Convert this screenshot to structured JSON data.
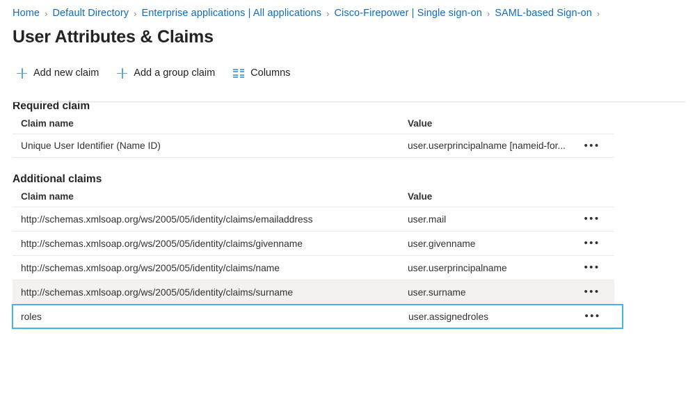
{
  "breadcrumb": {
    "separator": "›",
    "items": [
      {
        "label": "Home"
      },
      {
        "label": "Default Directory"
      },
      {
        "label": "Enterprise applications | All applications"
      },
      {
        "label": "Cisco-Firepower | Single sign-on"
      },
      {
        "label": "SAML-based Sign-on"
      }
    ]
  },
  "page": {
    "title": "User Attributes & Claims"
  },
  "commandbar": {
    "items": [
      {
        "label": "Add new claim",
        "icon": "plus-icon"
      },
      {
        "label": "Add a group claim",
        "icon": "plus-icon"
      },
      {
        "label": "Columns",
        "icon": "columns-icon"
      }
    ]
  },
  "required_section": {
    "title": "Required claim",
    "columns": {
      "name": "Claim name",
      "value": "Value"
    },
    "rows": [
      {
        "name": "Unique User Identifier (Name ID)",
        "value": "user.userprincipalname [nameid-for...",
        "menu": "•••",
        "state": "normal"
      }
    ]
  },
  "additional_section": {
    "title": "Additional claims",
    "columns": {
      "name": "Claim name",
      "value": "Value"
    },
    "rows": [
      {
        "name": "http://schemas.xmlsoap.org/ws/2005/05/identity/claims/emailaddress",
        "value": "user.mail",
        "menu": "•••",
        "state": "normal"
      },
      {
        "name": "http://schemas.xmlsoap.org/ws/2005/05/identity/claims/givenname",
        "value": "user.givenname",
        "menu": "•••",
        "state": "normal"
      },
      {
        "name": "http://schemas.xmlsoap.org/ws/2005/05/identity/claims/name",
        "value": "user.userprincipalname",
        "menu": "•••",
        "state": "normal"
      },
      {
        "name": "http://schemas.xmlsoap.org/ws/2005/05/identity/claims/surname",
        "value": "user.surname",
        "menu": "•••",
        "state": "hovered"
      },
      {
        "name": "roles",
        "value": "user.assignedroles",
        "menu": "•••",
        "state": "focused"
      }
    ]
  },
  "colors": {
    "link": "#0f6cbd",
    "icon_blue": "#5aa7dd",
    "focus_border": "#41b6e6",
    "hover_row": "#f3f2f1",
    "row_border": "#edebe9",
    "title": "#242424"
  }
}
